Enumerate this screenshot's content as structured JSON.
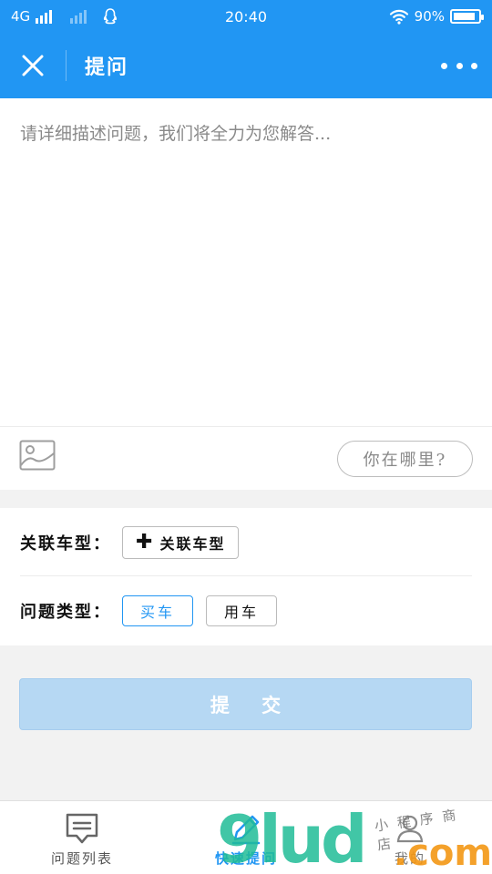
{
  "status_bar": {
    "network": "4G",
    "time": "20:40",
    "battery": "90%",
    "battery_level": 0.9,
    "icons": [
      "signal-icon",
      "signal-weak-icon",
      "qq-icon",
      "wifi-icon",
      "battery-icon"
    ]
  },
  "nav": {
    "title": "提问",
    "icons": [
      "close-icon",
      "more-icon"
    ]
  },
  "question": {
    "placeholder": "请详细描述问题，我们将全力为您解答...",
    "value": "",
    "image_icon": "image-icon",
    "location_label": "你在哪里?"
  },
  "options": {
    "car_model_label": "关联车型：",
    "car_model_button": "关联车型",
    "question_type_label": "问题类型：",
    "types": [
      {
        "label": "买车",
        "selected": true
      },
      {
        "label": "用车",
        "selected": false
      }
    ]
  },
  "submit_label": "提 交",
  "tabs": [
    {
      "label": "问题列表",
      "icon": "chat-list-icon",
      "active": false
    },
    {
      "label": "快速提问",
      "icon": "edit-icon",
      "active": true
    },
    {
      "label": "我的",
      "icon": "user-icon",
      "active": false
    }
  ],
  "watermark": {
    "brand": "9lud",
    "domain": ".com",
    "shop": "小程序商店"
  },
  "colors": {
    "primary": "#2196f3",
    "submit_disabled": "#b6d8f3",
    "background": "#f2f2f2",
    "watermark_green": "#20bc96",
    "watermark_orange": "#f39714"
  }
}
